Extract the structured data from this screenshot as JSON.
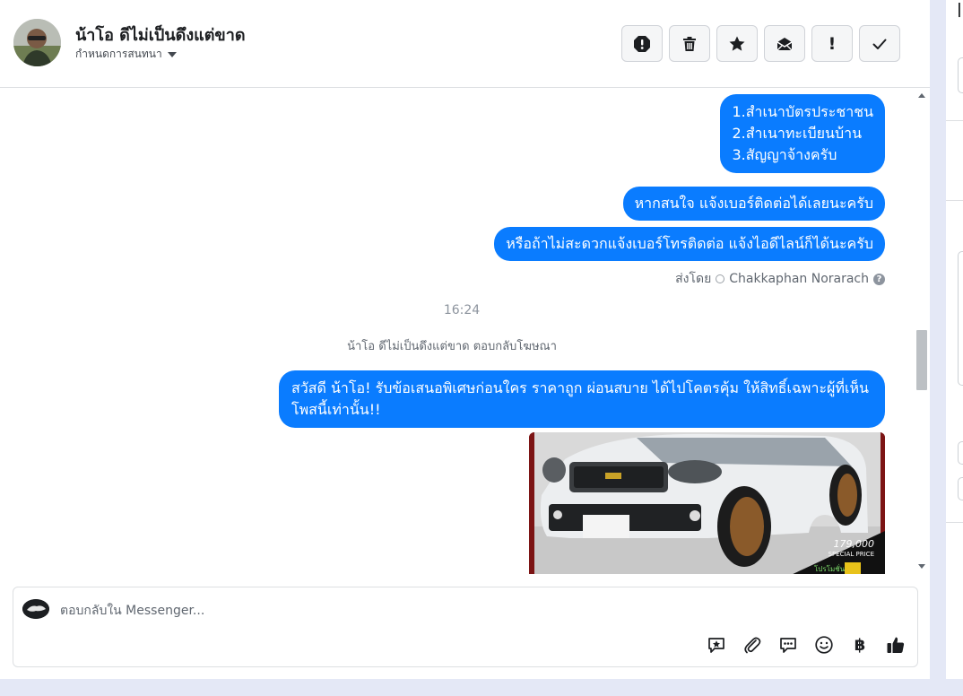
{
  "header": {
    "contact_name": "น้าโอ ดีไม่เป็นดึงแต่ขาด",
    "assign_label": "กำหนดการสนทนา"
  },
  "toolbar": {
    "buttons": [
      {
        "icon": "spam-alert-icon"
      },
      {
        "icon": "trash-icon"
      },
      {
        "icon": "star-icon"
      },
      {
        "icon": "mark-unread-icon"
      },
      {
        "icon": "follow-up-icon",
        "glyph": "!"
      },
      {
        "icon": "done-check-icon"
      }
    ]
  },
  "messages": {
    "docs_list": [
      "1.สำเนาบัตรประชาชน",
      "2.สำเนาทะเบียนบ้าน",
      "3.สัญญาจ้างครับ"
    ],
    "interested": "หากสนใจ แจ้งเบอร์ติดต่อได้เลยนะครับ",
    "inconvenient": "หรือถ้าไม่สะดวกแจ้งเบอร์โทรติดต่อ แจ้งไอดีไลน์ก็ได้นะครับ",
    "sent_by_prefix": "ส่งโดย",
    "sent_by_name": "Chakkaphan Norarach",
    "time": "16:24",
    "ad_reply_notice": "น้าโอ ดีไม่เป็นดึงแต่ขาด ตอบกลับโฆษณา",
    "ad_message": "สวัสดี น้าโอ! รับข้อเสนอพิเศษก่อนใคร ราคาถูก ผ่อนสบาย ได้ไปโคตรคุ้ม ให้สิทธิ์เฉพาะผู้ที่เห็นโพสนี้เท่านั้น!!",
    "ad_image": {
      "price": "179,000",
      "price_caption": "SPECIAL PRICE",
      "promo_label": "โปรโมชั่น"
    }
  },
  "composer": {
    "placeholder": "ตอบกลับใน Messenger...",
    "tools": [
      "saved-reply-icon",
      "attachment-icon",
      "chat-bubble-icon",
      "emoji-icon",
      "baht-icon",
      "thumbs-up-icon"
    ],
    "baht_glyph": "฿"
  },
  "colors": {
    "bubble": "#0a7cff",
    "background": "#e4e8f6"
  }
}
